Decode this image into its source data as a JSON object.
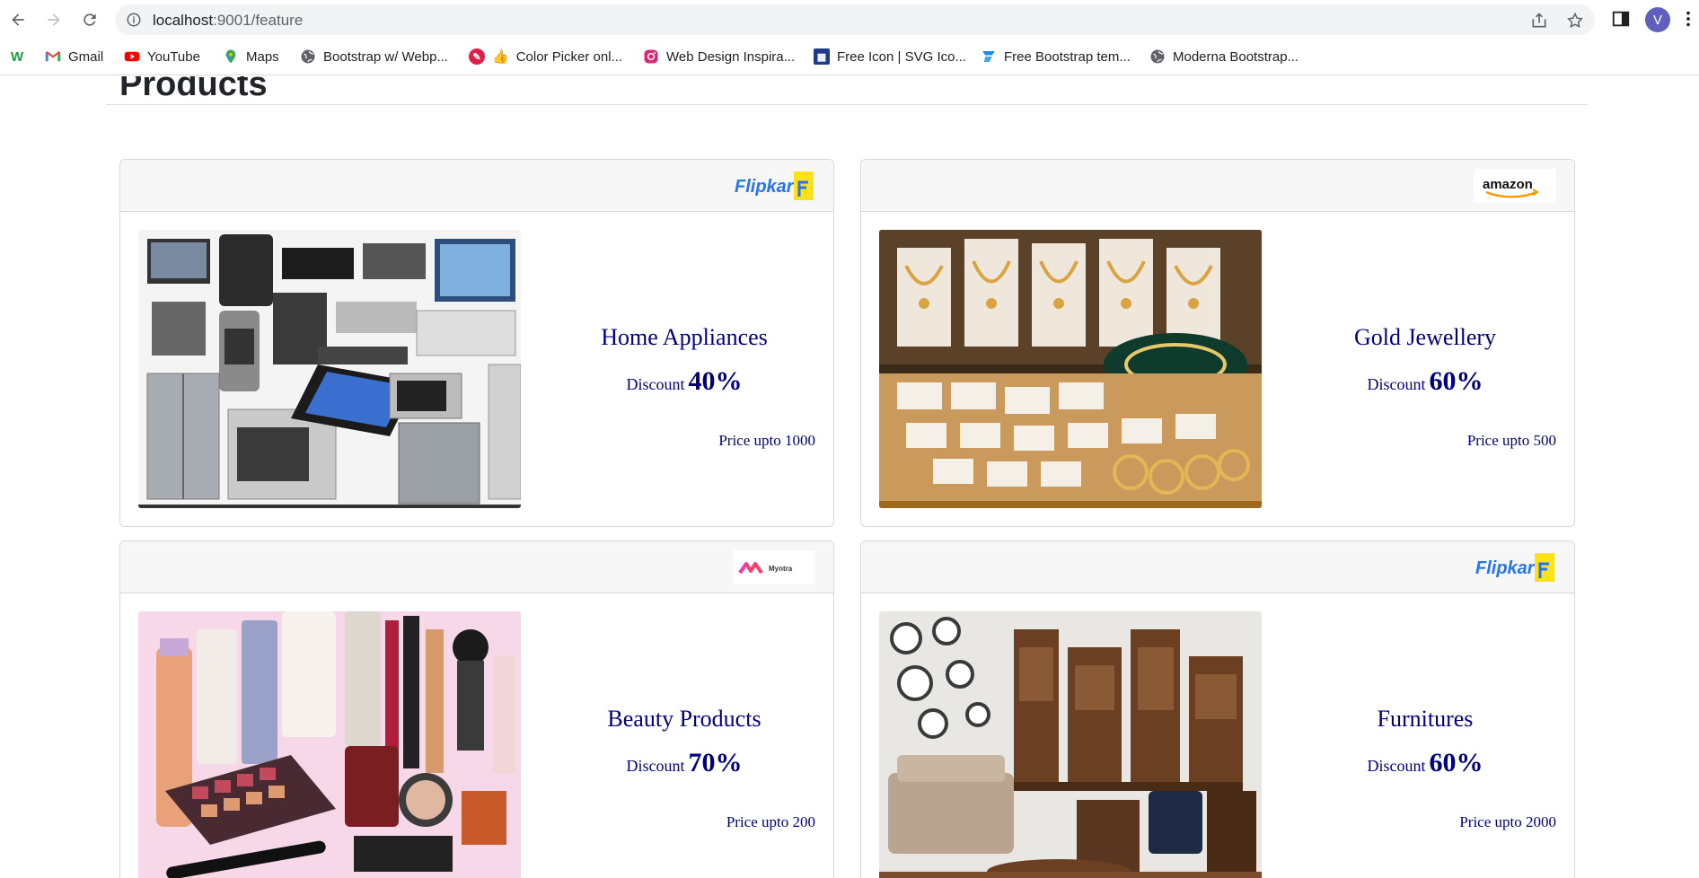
{
  "browser": {
    "url_host": "localhost",
    "url_path": ":9001/feature",
    "avatar_letter": "V",
    "bookmarks": [
      {
        "label": "",
        "icon": "w-icon"
      },
      {
        "label": "Gmail",
        "icon": "gmail-icon"
      },
      {
        "label": "YouTube",
        "icon": "youtube-icon"
      },
      {
        "label": "Maps",
        "icon": "maps-icon"
      },
      {
        "label": "Bootstrap w/ Webp...",
        "icon": "globe-icon"
      },
      {
        "label": "Color Picker onl...",
        "icon": "color-picker-icon",
        "emoji": "👍"
      },
      {
        "label": "Web Design Inspira...",
        "icon": "instagram-icon"
      },
      {
        "label": "Free Icon | SVG Ico...",
        "icon": "svg-icon"
      },
      {
        "label": "Free Bootstrap tem...",
        "icon": "bootstrap-template-icon"
      },
      {
        "label": "Moderna Bootstrap...",
        "icon": "globe-icon"
      }
    ]
  },
  "page": {
    "heading": "Products"
  },
  "products": [
    {
      "vendor": "Flipkart",
      "title": "Home Appliances",
      "discount_label": "Discount",
      "discount_value": "40%",
      "price": "Price upto 1000",
      "image": "home-appliances-image"
    },
    {
      "vendor": "amazon",
      "title": "Gold Jewellery",
      "discount_label": "Discount",
      "discount_value": "60%",
      "price": "Price upto 500",
      "image": "gold-jewellery-image"
    },
    {
      "vendor": "Myntra",
      "title": "Beauty Products",
      "discount_label": "Discount",
      "discount_value": "70%",
      "price": "Price upto 200",
      "image": "beauty-products-image"
    },
    {
      "vendor": "Flipkart",
      "title": "Furnitures",
      "discount_label": "Discount",
      "discount_value": "60%",
      "price": "Price upto 2000",
      "image": "furnitures-image"
    }
  ],
  "colors": {
    "text_navy": "#000080",
    "flipkart_blue": "#2874f0",
    "flipkart_yellow": "#ffe11b",
    "amazon_orange": "#ff9900",
    "avatar": "#5e5fbf"
  }
}
